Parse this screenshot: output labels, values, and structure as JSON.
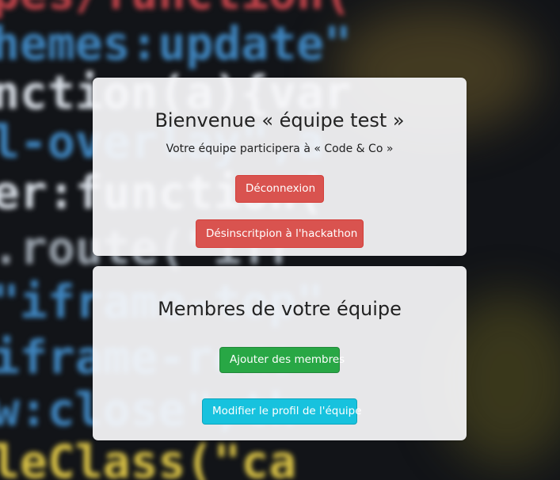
{
  "background": {
    "lines": [
      "pes/function(",
      "hemes:update\"",
      "nction(a){var",
      "l-overlay\",a",
      "er:function(",
      ".route(\"ifr",
      "\"iframe-top\"",
      "iframe-remo",
      "w:close\",th",
      "leClass(\"ca"
    ]
  },
  "welcome": {
    "title": "Bienvenue « équipe test »",
    "subtitle": "Votre équipe participera à « Code & Co »",
    "logout_label": "Déconnexion",
    "unsubscribe_label": "Désinscritpion à l'hackathon"
  },
  "members": {
    "title": "Membres de votre équipe",
    "add_label": "Ajouter des membres",
    "edit_label": "Modifier le profil de l'équipe"
  },
  "colors": {
    "danger": "#d9534f",
    "success": "#28a745",
    "info": "#17c2de",
    "card": "#f8f8fa"
  }
}
